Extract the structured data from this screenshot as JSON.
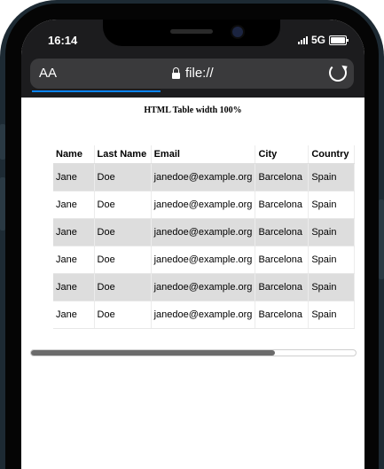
{
  "status_bar": {
    "time": "16:14",
    "network": "5G"
  },
  "address_bar": {
    "text_size_label": "AA",
    "url": "file://"
  },
  "page": {
    "title": "HTML Table width 100%"
  },
  "table": {
    "headers": [
      "Name",
      "Last Name",
      "Email",
      "City",
      "Country"
    ],
    "rows": [
      [
        "Jane",
        "Doe",
        "janedoe@example.org",
        "Barcelona",
        "Spain"
      ],
      [
        "Jane",
        "Doe",
        "janedoe@example.org",
        "Barcelona",
        "Spain"
      ],
      [
        "Jane",
        "Doe",
        "janedoe@example.org",
        "Barcelona",
        "Spain"
      ],
      [
        "Jane",
        "Doe",
        "janedoe@example.org",
        "Barcelona",
        "Spain"
      ],
      [
        "Jane",
        "Doe",
        "janedoe@example.org",
        "Barcelona",
        "Spain"
      ],
      [
        "Jane",
        "Doe",
        "janedoe@example.org",
        "Barcelona",
        "Spain"
      ]
    ]
  },
  "colors": {
    "frame": "#1d2a33",
    "browser_bar": "#1c1c1e",
    "url_pill": "#3a3a3c",
    "accent": "#0a84ff",
    "stripe": "#dddddd"
  },
  "scroll": {
    "horizontal_fraction_visible": 0.75
  }
}
